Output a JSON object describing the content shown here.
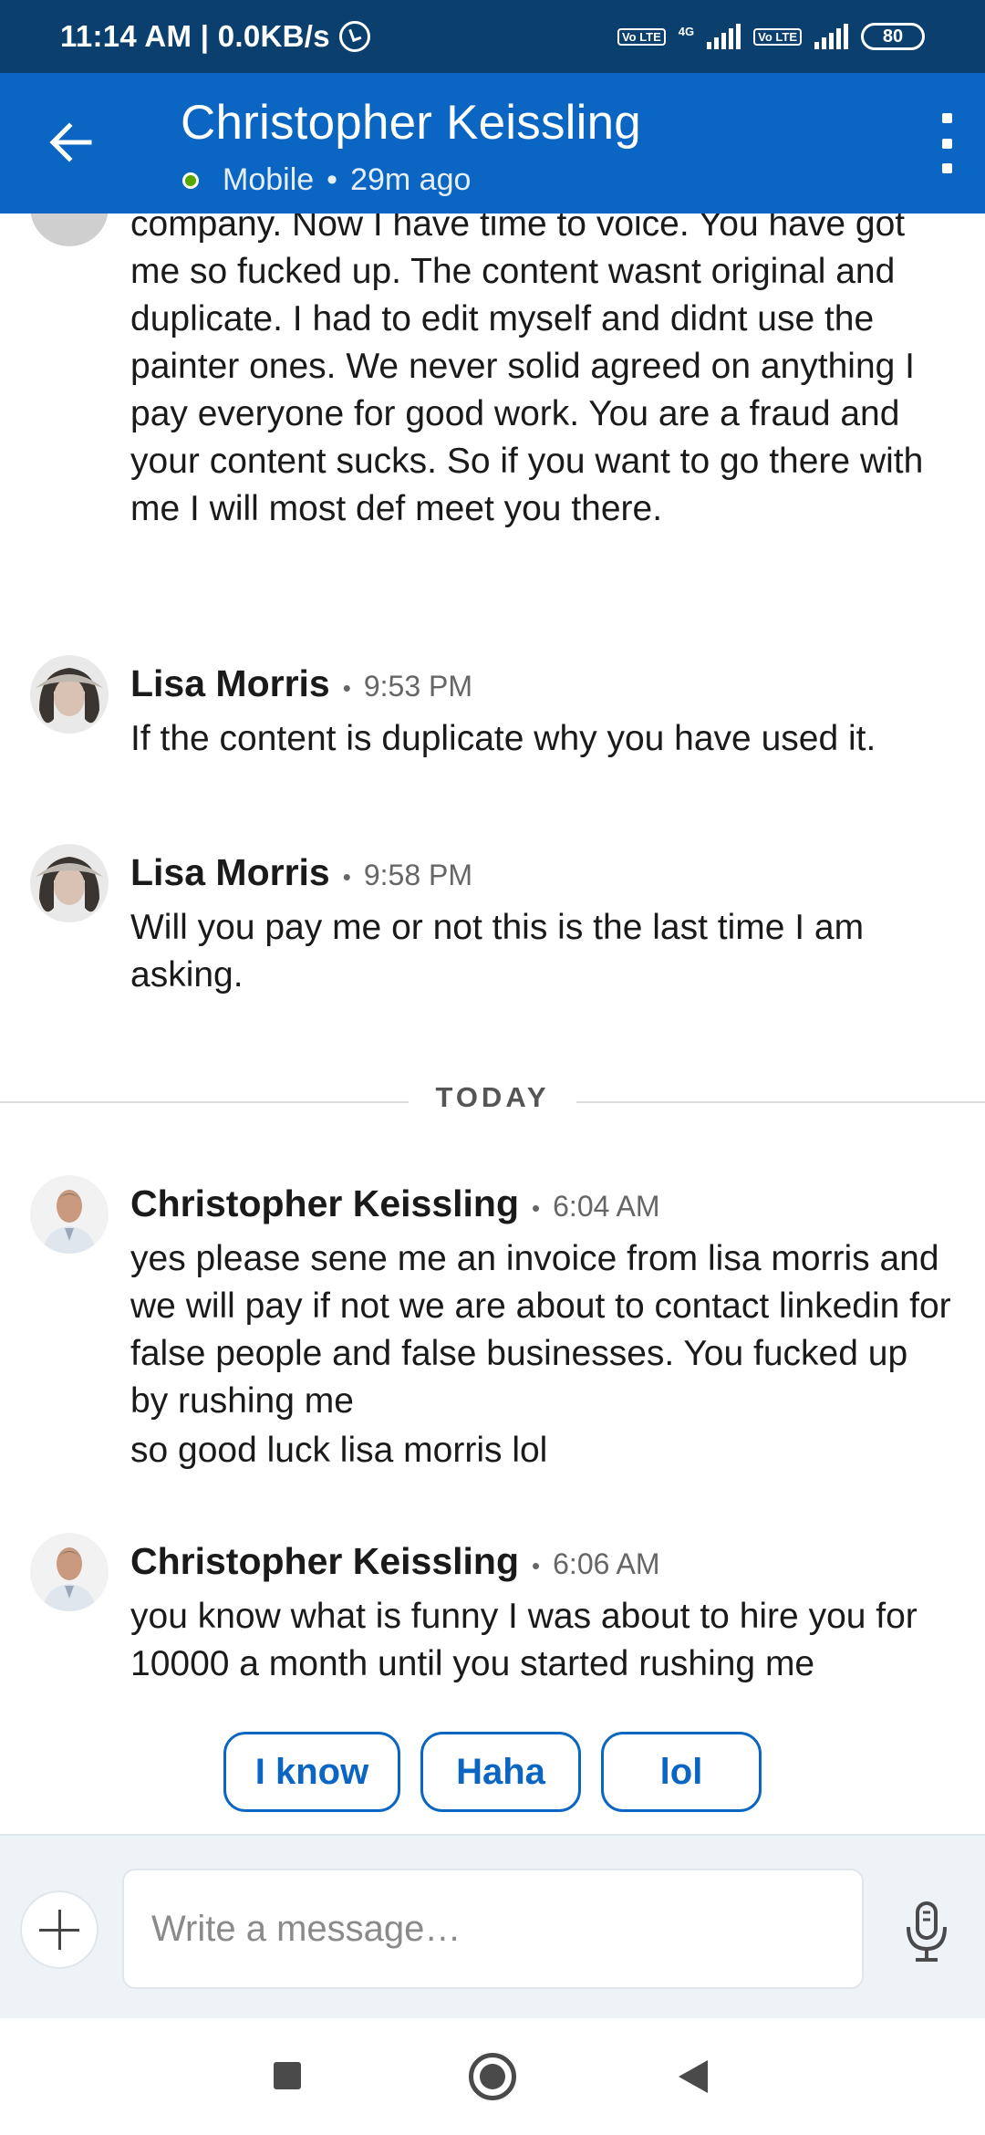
{
  "status_bar": {
    "time_speed": "11:14 AM | 0.0KB/s",
    "network_type": "4G",
    "volte_label": "Vo LTE",
    "battery": "80"
  },
  "header": {
    "contact_name": "Christopher Keissling",
    "presence": "Mobile",
    "last_seen": "29m ago"
  },
  "conversation": {
    "partial_message": "You need to send the correct invoice from a legit company. Now I have time to voice. You have got me so fucked up. The content wasnt original and duplicate. I had to edit myself and didnt use the painter ones. We never solid agreed on anything I pay  everyone for good work. You are a fraud and your content sucks. So if you want to go there with me I will most def meet you there.",
    "messages": [
      {
        "sender": "Lisa Morris",
        "time": "9:53 PM",
        "text": "If the content is duplicate why you have used it."
      },
      {
        "sender": "Lisa Morris",
        "time": "9:58 PM",
        "text": "Will you pay me or not this is the last time I am asking."
      },
      {
        "sender": "Christopher Keissling",
        "time": "6:04 AM",
        "text": "yes please sene me an invoice from lisa morris and we will pay if not we are about to contact linkedin for false people and false businesses. You fucked up by rushing me",
        "followup": "so good luck lisa morris lol"
      },
      {
        "sender": "Christopher Keissling",
        "time": "6:06 AM",
        "text": "you know what is funny I was about to hire you for 10000 a month until you started rushing me"
      }
    ],
    "divider_label": "TODAY"
  },
  "quick_replies": [
    "I know",
    "Haha",
    "lol"
  ],
  "composer": {
    "placeholder": "Write a message…"
  },
  "colors": {
    "status_bar": "#0a3f6e",
    "header": "#0a66c2",
    "accent": "#0a66c2",
    "online": "#57a700"
  },
  "icons": {
    "back": "back-arrow-icon",
    "more": "more-vertical-icon",
    "add": "plus-icon",
    "mic": "microphone-icon"
  }
}
